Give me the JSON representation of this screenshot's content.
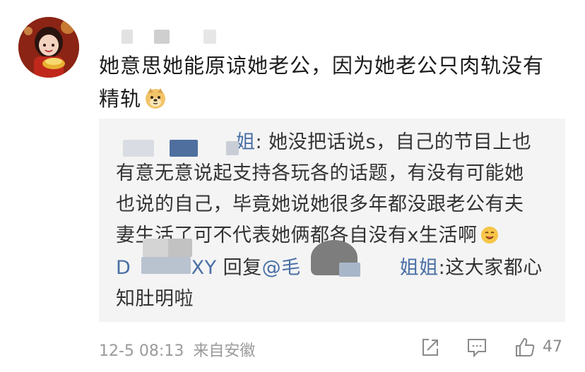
{
  "comment": {
    "main_text_line1": "她意思她能原谅她老公，因为她老公只肉轨没有",
    "main_text_line2": "精轨",
    "doge_emoji": "doge-emoji"
  },
  "quote": {
    "line1_name_tail": "姐",
    "line1_text": ": 她没把话说s，自己的节目上也",
    "line2": "有意无意说起支持各玩各的话题，有没有可能她",
    "line3": "也说的自己，毕竟她说她很多年都没跟老公有夫",
    "line4_a": "妻生活了可不代表她俩都各自没有x生活啊",
    "line5_prefix": "D",
    "line5_user_tail": "DXY",
    "line5_reply": "回复",
    "line5_at": "@毛",
    "line5_name_tail": "姐姐",
    "line5_text": ":这大家都心",
    "line6": "知肚明啦"
  },
  "footer": {
    "timestamp": "12-5 08:13",
    "source": "来自安徽",
    "like_count": "47",
    "icons": [
      "share-icon",
      "comment-icon",
      "like-icon"
    ]
  },
  "colors": {
    "link": "#4a6fa5",
    "quote_bg": "#f4f4f4",
    "meta": "#9a9a9a"
  }
}
